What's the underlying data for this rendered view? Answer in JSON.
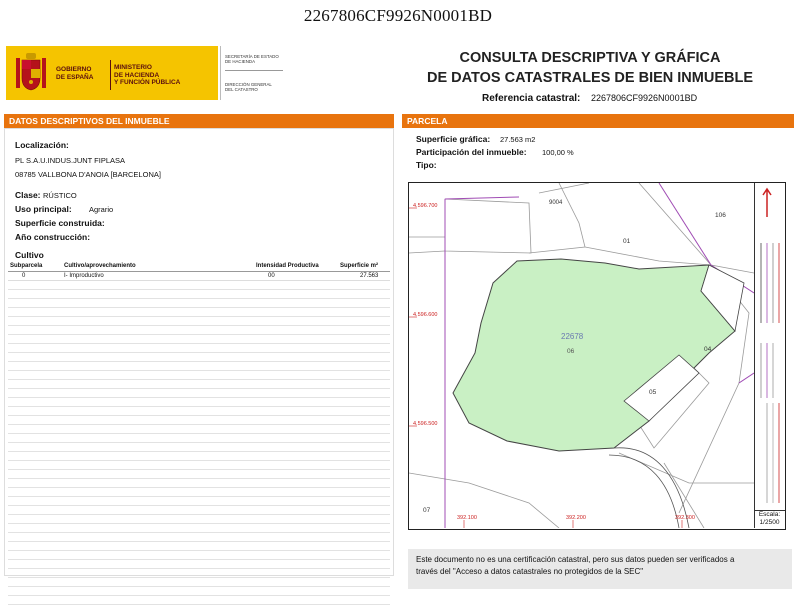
{
  "top_reference": "2267806CF9926N0001BD",
  "header": {
    "gov_spain": "GOBIERNO\nDE ESPAÑA",
    "ministry": "MINISTERIO\nDE HACIENDA\nY FUNCIÓN PÚBLICA",
    "secretaria": "SECRETARÍA DE ESTADO\nDE HACIENDA",
    "direccion": "DIRECCIÓN GENERAL\nDEL CATASTRO",
    "title_line1": "CONSULTA DESCRIPTIVA Y GRÁFICA",
    "title_line2": "DE DATOS CATASTRALES DE BIEN INMUEBLE",
    "ref_label": "Referencia catastral:",
    "ref_value": "2267806CF9926N0001BD",
    "brand_color": "#f5c400"
  },
  "left": {
    "section_title": "DATOS DESCRIPTIVOS DEL INMUEBLE",
    "localizacion_label": "Localización:",
    "localizacion_line1": "PL S.A.U.INDUS.JUNT FIPLASA",
    "localizacion_line2": "08785 VALLBONA D'ANOIA [BARCELONA]",
    "clase_label": "Clase:",
    "clase_value": "RÚSTICO",
    "uso_label": "Uso principal:",
    "uso_value": "Agrario",
    "superficie_label": "Superficie construida:",
    "anio_label": "Año construcción:",
    "cultivo_title": "Cultivo",
    "cultivo_headers": [
      "Subparcela",
      "Cultivo/aprovechamiento",
      "Intensidad Productiva",
      "Superficie m²"
    ],
    "cultivo_rows": [
      {
        "subparcela": "0",
        "cultivo": "I- Improductivo",
        "intensidad": "00",
        "superficie": "27.563"
      }
    ]
  },
  "right": {
    "section_title": "PARCELA",
    "sup_grafica_label": "Superficie gráfica:",
    "sup_grafica_value": "27.563 m2",
    "participacion_label": "Participación del inmueble:",
    "participacion_value": "100,00 %",
    "tipo_label": "Tipo:",
    "map": {
      "parcel_label": "22678",
      "parcel_sub": "06",
      "neighbors": [
        "9004",
        "106",
        "01",
        "04",
        "05",
        "07"
      ],
      "coord_y": [
        "4.596.700",
        "4.596.600",
        "4.596.500"
      ],
      "coord_x": [
        "392.100",
        "392.200",
        "392.300"
      ],
      "parcel_fill": "#c9f0c4",
      "coord_color": "#cc2222",
      "escala_label": "Escala:",
      "escala_value": "1/2500"
    }
  },
  "note": {
    "line1": "Este documento no es una certificación catastral, pero sus datos pueden ser verificados a",
    "line2": "través del \"Acceso a datos catastrales no protegidos de la SEC\""
  },
  "accent_color": "#e8740e"
}
